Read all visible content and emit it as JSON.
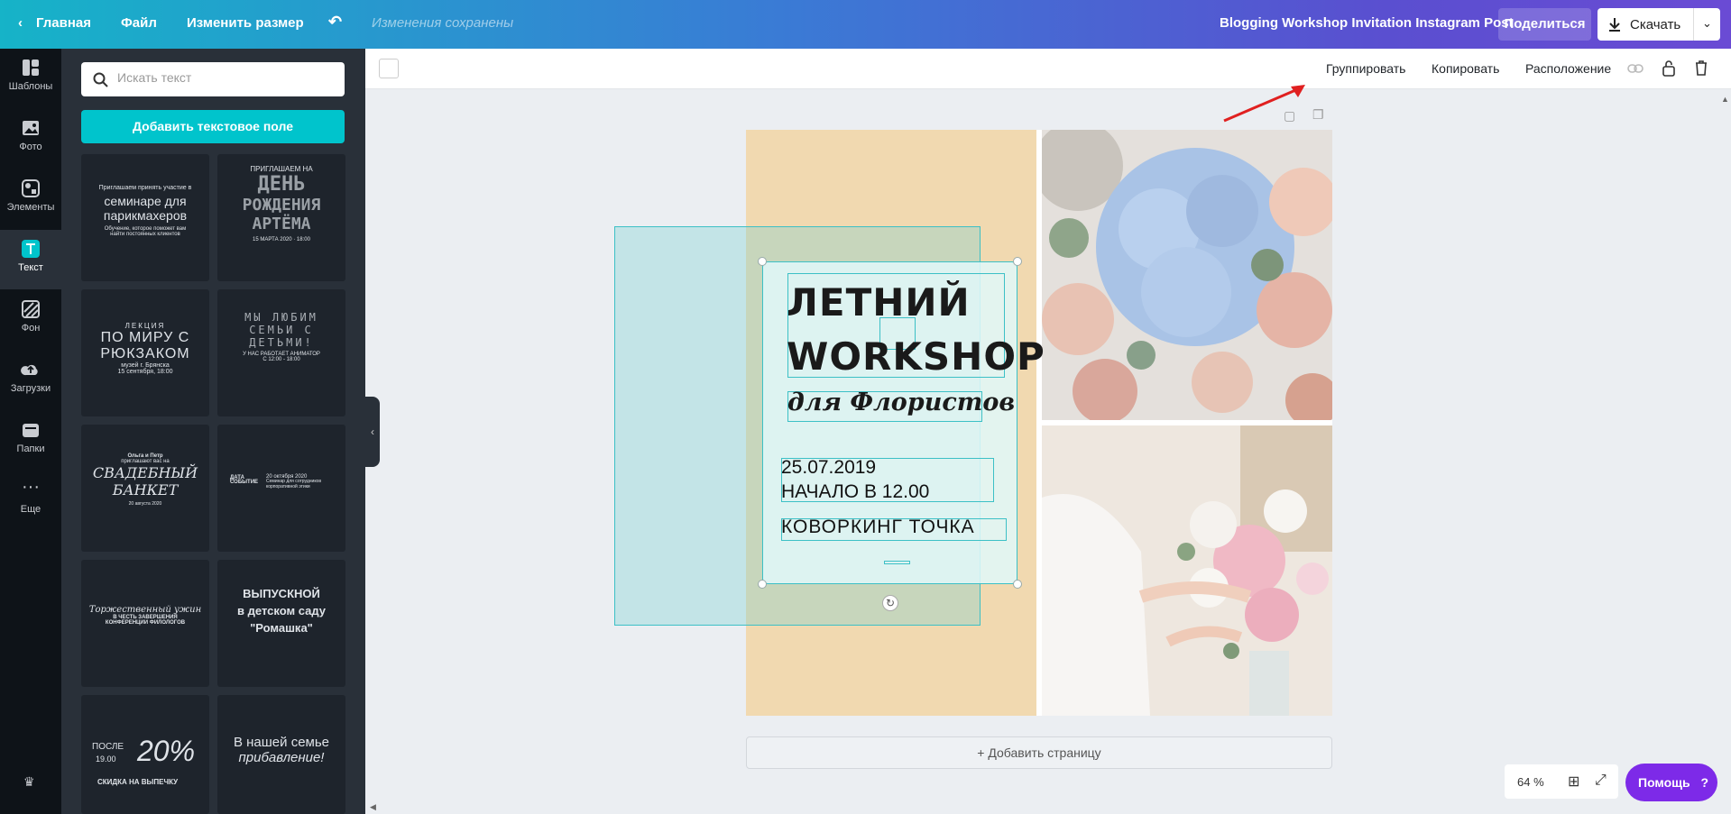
{
  "topbar": {
    "home": "Главная",
    "file": "Файл",
    "resize": "Изменить размер",
    "saved_status": "Изменения сохранены",
    "doc_title": "Blogging Workshop Invitation Instagram Post",
    "share": "Поделиться",
    "download": "Скачать"
  },
  "rail": [
    {
      "label": "Шаблоны",
      "icon": "templates-icon"
    },
    {
      "label": "Фото",
      "icon": "photo-icon"
    },
    {
      "label": "Элементы",
      "icon": "elements-icon"
    },
    {
      "label": "Текст",
      "icon": "text-icon"
    },
    {
      "label": "Фон",
      "icon": "background-icon"
    },
    {
      "label": "Загрузки",
      "icon": "uploads-icon"
    },
    {
      "label": "Папки",
      "icon": "folders-icon"
    },
    {
      "label": "Еще",
      "icon": "more-icon"
    }
  ],
  "panel": {
    "search_placeholder": "Искать текст",
    "add_text": "Добавить текстовое поле",
    "templates": [
      {
        "l1": "Приглашаем принять участие в",
        "l2": "семинаре для",
        "l3": "парикмахеров",
        "l4": "Обучение, которое поможет вам",
        "l5": "найти постоянных клиентов"
      },
      {
        "l1": "ПРИГЛАШАЕМ НА",
        "l2": "ДЕНЬ",
        "l3": "РОЖДЕНИЯ",
        "l4": "АРТЁМА",
        "l5": "15 МАРТА 2020 · 18:00"
      },
      {
        "l1": "ЛЕКЦИЯ",
        "l2": "ПО МИРУ С",
        "l3": "РЮКЗАКОМ",
        "l4": "музей г. Брянска",
        "l5": "15 сентября, 18:00"
      },
      {
        "l1": "МЫ ЛЮБИМ",
        "l2": "СЕМЬИ С",
        "l3": "ДЕТЬМИ!",
        "l4": "У НАС РАБОТАЕТ АНИМАТОР",
        "l5": "С 12:00 - 18:00"
      },
      {
        "l1": "Ольга и Петр",
        "l2": "приглашают вас на",
        "l3": "СВАДЕБНЫЙ",
        "l4": "БАНКЕТ",
        "l5": "20 августа 2020"
      },
      {
        "l1": "ДАТА",
        "l2": "20 октября 2020",
        "l3": "СОБЫТИЕ",
        "l4": "Семинар для сотрудников",
        "l5": "корпоративной этики"
      },
      {
        "l1": "Торжественный ужин",
        "l2": "В ЧЕСТЬ ЗАВЕРШЕНИЯ",
        "l3": "КОНФЕРЕНЦИИ ФИЛОЛОГОВ",
        "l4": "",
        "l5": ""
      },
      {
        "l1": "ВЫПУСКНОЙ",
        "l2": "в детском саду",
        "l3": "\"Ромашка\"",
        "l4": "",
        "l5": ""
      },
      {
        "l1": "ПОСЛЕ",
        "l2": "19.00",
        "l3": "20%",
        "l4": "СКИДКА НА ВЫПЕЧКУ",
        "l5": ""
      },
      {
        "l1": "В нашей семье",
        "l2": "прибавление!",
        "l3": "",
        "l4": "",
        "l5": ""
      }
    ]
  },
  "toolbar": {
    "group": "Группировать",
    "copy": "Копировать",
    "arrange": "Расположение"
  },
  "design": {
    "title_line1": "ЛЕТНИЙ",
    "title_line2": "WORKSHOP",
    "subtitle": "для Флористов",
    "date": "25.07.2019",
    "time": "НАЧАЛО В 12.00",
    "venue": "КОВОРКИНГ ТОЧКА"
  },
  "add_page": "+ Добавить страницу",
  "zoom": "64 %",
  "help": "Помощь",
  "colors": {
    "accent": "#00c4cc",
    "help": "#7d2ae8",
    "selection": "#3cc0c6"
  }
}
